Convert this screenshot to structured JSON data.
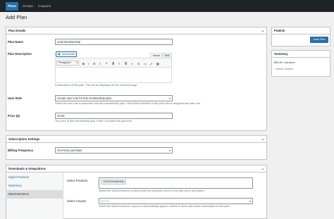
{
  "topnav": {
    "tabs": [
      {
        "label": "Plans",
        "active": true
      },
      {
        "label": "Groups",
        "active": false
      },
      {
        "label": "Coupons",
        "active": false
      }
    ]
  },
  "page_title": "Add Plan",
  "plan_details": {
    "heading": "Plan Details",
    "plan_name_label": "Plan Name",
    "plan_name_value": "Gold Membership",
    "plan_description_label": "Plan Description",
    "add_media_label": "Add Media",
    "visual_tab": "Visual",
    "text_tab": "Text",
    "paragraph_select": "Paragraph",
    "description_help": "A description of this plan. This will be displayed on the checkout page.",
    "user_role_label": "User Role",
    "user_role_value": "Create user role for this membership plan",
    "user_role_help": "Select the user role to associate with this membership plan. Users that subscribe to this plan will be assigned this user role.",
    "price_label": "Price ($)",
    "price_value": "20.00",
    "price_help": "The price of this membership plan. Enter 0 to make this plan free."
  },
  "subscription_settings": {
    "heading": "Subscription Settings",
    "billing_label": "Billing Frequency",
    "billing_value": "One-time purchase"
  },
  "downloads": {
    "heading": "Downloads & Integrations",
    "tabs": [
      {
        "label": "Digital Products",
        "active": false
      },
      {
        "label": "Mailchimp",
        "active": false
      },
      {
        "label": "WooCommerce",
        "active": true
      }
    ],
    "select_products_label": "Select Products",
    "product_tag": "Gold Membership",
    "products_help": "Select the WooCommerce products that will subscribe users to this plan when purchased.",
    "select_coupon_label": "Select Coupon",
    "coupon_value": "———",
    "coupon_help": "Select the WooCommerce coupon to automatically apply to orders of users with active subscription to this plan."
  },
  "publish": {
    "heading": "Publish",
    "save_label": "Save Plan"
  },
  "summary": {
    "heading": "Summary",
    "price_line": "$20.00 / one-time",
    "expiry_line": "Never expires"
  },
  "colors": {
    "admin_bar": "#1d2327",
    "accent": "#2271b1",
    "background": "#f0f0f1"
  }
}
